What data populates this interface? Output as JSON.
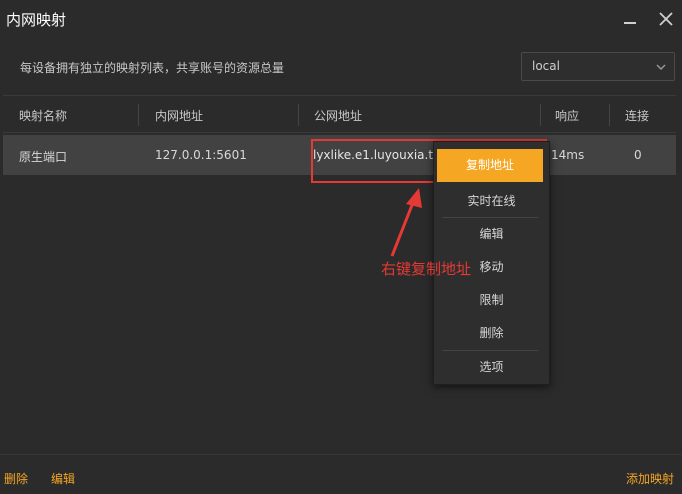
{
  "window": {
    "title": "内网映射"
  },
  "info": {
    "description": "每设备拥有独立的映射列表，共享账号的资源总量",
    "selected_device": "local"
  },
  "table": {
    "columns": [
      "映射名称",
      "内网地址",
      "公网地址",
      "响应",
      "连接"
    ],
    "rows": [
      {
        "name": "原生端口",
        "local": "127.0.0.1:5601",
        "public": "lyxlike.e1.luyouxia.top",
        "latency": "14ms",
        "connections": "0"
      }
    ]
  },
  "context_menu": {
    "items": [
      "复制地址",
      "实时在线",
      "编辑",
      "移动",
      "限制",
      "删除",
      "选项"
    ],
    "active": "复制地址"
  },
  "annotation": {
    "text": "右键复制地址",
    "color": "#e53935"
  },
  "footer": {
    "delete_label": "删除",
    "edit_label": "编辑",
    "add_label": "添加映射"
  },
  "colors": {
    "accent": "#f5a623",
    "background": "#2b2b2b",
    "row_selected": "#424242"
  },
  "icons": {
    "minimize": "minimize-icon",
    "close": "close-icon",
    "dropdown": "chevron-down-icon",
    "annotation_arrow": "arrow-icon"
  }
}
